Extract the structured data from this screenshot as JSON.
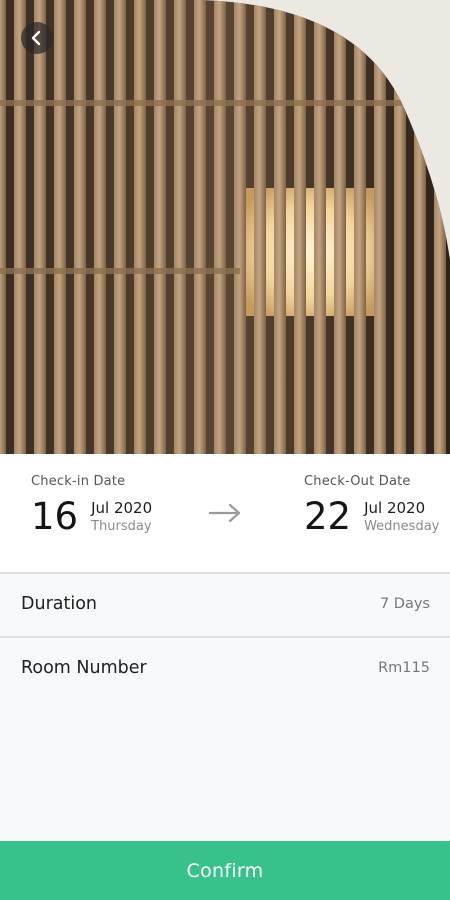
{
  "header": {
    "back_icon": "chevron-left-icon"
  },
  "booking": {
    "check_in": {
      "label": "Check-in Date",
      "day": "16",
      "month_year": "Jul 2020",
      "weekday": "Thursday"
    },
    "arrow_icon": "arrow-right-icon",
    "check_out": {
      "label": "Check-Out Date",
      "day": "22",
      "month_year": "Jul 2020",
      "weekday": "Wednesday"
    }
  },
  "details": {
    "duration": {
      "label": "Duration",
      "value": "7 Days"
    },
    "room_number": {
      "label": "Room Number",
      "value": "Rm115"
    }
  },
  "actions": {
    "confirm_label": "Confirm"
  },
  "colors": {
    "accent": "#39c18c",
    "background": "#f8f9fa"
  }
}
